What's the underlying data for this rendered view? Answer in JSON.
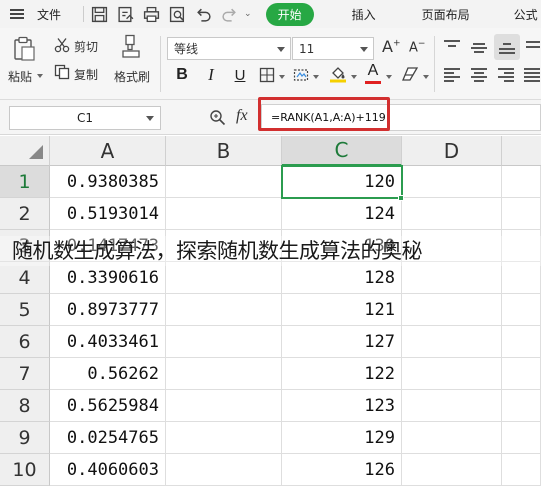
{
  "menu": {
    "file_label": "文件",
    "tabs": [
      {
        "label": "开始",
        "active": true
      },
      {
        "label": "插入",
        "active": false
      },
      {
        "label": "页面布局",
        "active": false
      },
      {
        "label": "公式",
        "active": false
      }
    ],
    "quick_access_icons": [
      "save-icon",
      "export-pdf-icon",
      "print-icon",
      "print-preview-icon",
      "undo-icon",
      "redo-icon"
    ]
  },
  "ribbon": {
    "paste_label": "粘贴",
    "cut_label": "剪切",
    "copy_label": "复制",
    "format_painter_label": "格式刷",
    "font_name": "等线",
    "font_size": "11",
    "bold": "B",
    "italic": "I",
    "underline": "U",
    "font_color_glyph": "A",
    "increase_font": "A",
    "decrease_font": "A"
  },
  "formula_bar": {
    "name_box": "C1",
    "fx_label": "fx",
    "formula": "=RANK(A1,A:A)+119"
  },
  "columns": [
    "A",
    "B",
    "C",
    "D"
  ],
  "rows": [
    {
      "num": "1",
      "a": "0.9380385",
      "c": "120"
    },
    {
      "num": "2",
      "a": "0.5193014",
      "c": "124"
    },
    {
      "num": "3",
      "a": "0.1417473",
      "c": "130"
    },
    {
      "num": "4",
      "a": "0.3390616",
      "c": "128"
    },
    {
      "num": "5",
      "a": "0.8973777",
      "c": "121"
    },
    {
      "num": "6",
      "a": "0.4033461",
      "c": "127"
    },
    {
      "num": "7",
      "a": "0.56262",
      "c": "122"
    },
    {
      "num": "8",
      "a": "0.5625984",
      "c": "123"
    },
    {
      "num": "9",
      "a": "0.0254765",
      "c": "129"
    },
    {
      "num": "10",
      "a": "0.4060603",
      "c": "126"
    }
  ],
  "selection": {
    "active_column": "C",
    "active_row": "1"
  },
  "overlay_caption": "随机数生成算法，探索随机数生成算法的奥秘",
  "colors": {
    "accent_green": "#27a844",
    "selection_green": "#2b9c4f",
    "highlight_red": "#d22f2f",
    "font_color_bar": "#e02020",
    "fill_color_bar": "#f5d000"
  }
}
